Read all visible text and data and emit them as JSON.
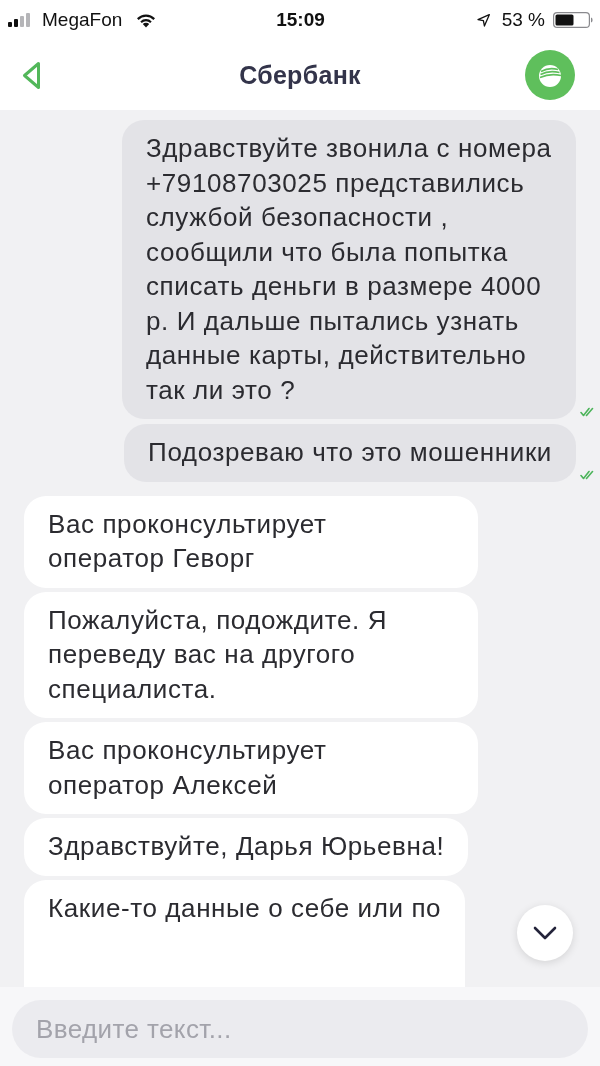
{
  "status_bar": {
    "carrier": "MegaFon",
    "time": "15:09",
    "battery_percent": "53 %"
  },
  "header": {
    "title": "Сбербанк"
  },
  "messages": [
    {
      "kind": "outgoing",
      "text": "Здравствуйте звонила с номера +79108703025 представились службой безопасности , сообщили что была попытка списать деньги в размере 4000 р. И дальше пытались узнать данные карты, действительно так ли это ?",
      "read": true
    },
    {
      "kind": "outgoing",
      "text": "Подозреваю что это мошенники",
      "read": true
    },
    {
      "kind": "incoming",
      "text": "Вас проконсультирует оператор Геворг"
    },
    {
      "kind": "incoming",
      "text": "Пожалуйста, подождите. Я переведу вас на другого специалиста."
    },
    {
      "kind": "incoming",
      "text": "Вас проконсультирует оператор Алексей"
    },
    {
      "kind": "incoming",
      "text": "Здравствуйте, Дарья Юрьевна!"
    },
    {
      "kind": "incoming",
      "text": "Какие-то данные о себе или по"
    }
  ],
  "composer": {
    "placeholder": "Введите текст..."
  }
}
